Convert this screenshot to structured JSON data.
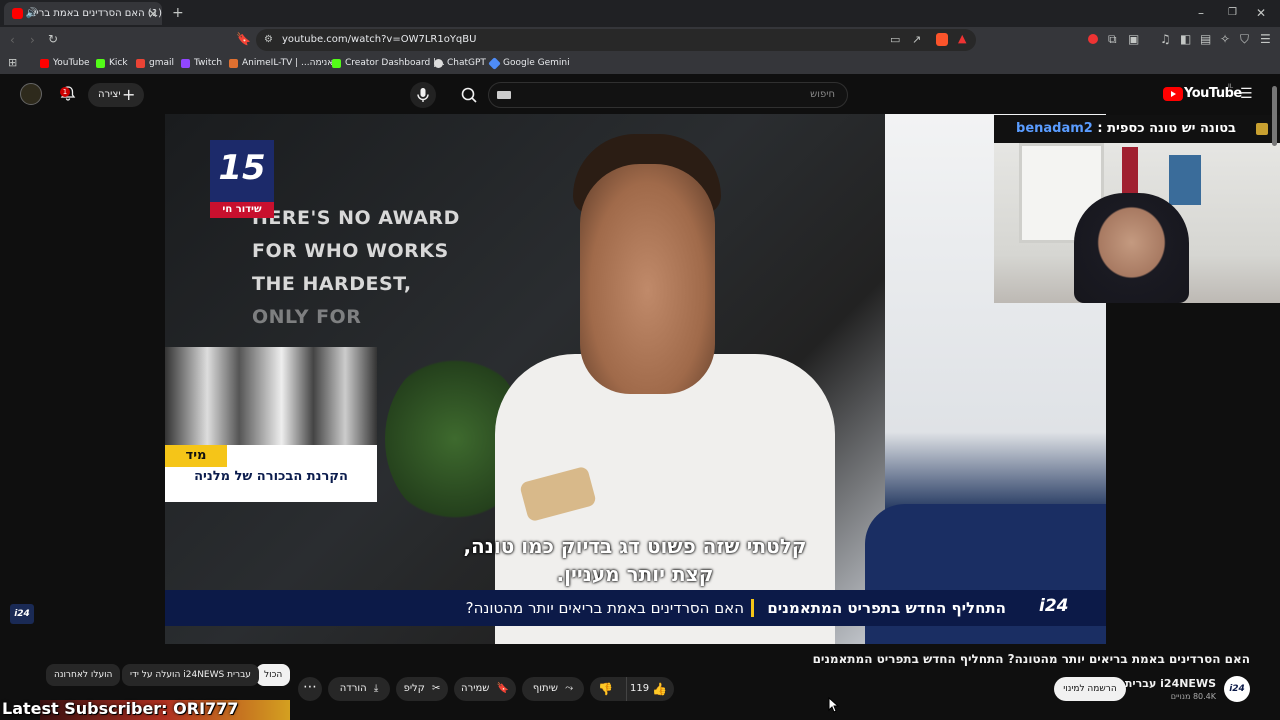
{
  "browser": {
    "tab_title": "(1) האם הסרדינים באמת בריא",
    "url": "youtube.com/watch?v=OW7LR1oYqBU",
    "bookmarks": [
      {
        "label": "YouTube",
        "color": "#ff0000"
      },
      {
        "label": "Kick",
        "color": "#53fc18"
      },
      {
        "label": "gmail",
        "color": "#ea4335"
      },
      {
        "label": "Twitch",
        "color": "#9146ff"
      },
      {
        "label": "AnimeIL-TV | ...אנימה",
        "color": "#e07030"
      },
      {
        "label": "Creator Dashboard |...",
        "color": "#53fc18"
      },
      {
        "label": "ChatGPT",
        "color": "#ffffff"
      },
      {
        "label": "Google Gemini",
        "color": "#4e8cf7"
      }
    ]
  },
  "youtube": {
    "logo_label": "YouTube",
    "logo_sup": "IL",
    "search_placeholder": "חיפוש",
    "create_label": "יצירה",
    "notification_count": "1"
  },
  "video": {
    "channel_badge_number": "15",
    "channel_badge_live": "שידור חי",
    "wall_text_lines": [
      "HERE'S NO AWARD",
      "FOR WHO WORKS",
      "THE HARDEST,",
      "ONLY FOR"
    ],
    "pip_tag": "מיד",
    "pip_text": "הקרנת הבכורה של מלניה",
    "subtitle_line1": "קלטתי שזה פשוט דג בדיוק כמו טונה,",
    "subtitle_line2": "קצת יותר מעניין.",
    "ticker_main": "התחליף החדש בתפריט המתאמנים",
    "ticker_sub": "האם הסרדינים באמת בריאים יותר מהטונה?",
    "ticker_logo": "i24",
    "side_logo": "i24"
  },
  "stream_overlay": {
    "chat_user": "benadam2",
    "chat_message": "בטונה יש טונה כספית",
    "latest_subscriber": "Latest Subscriber: ORI777"
  },
  "below": {
    "title": "האם הסרדינים באמת בריאים יותר מהטונה? התחליף החדש בתפריט המתאמנים",
    "channel_name": "i24NEWS עברית",
    "channel_subs": "80.4K מנויים",
    "channel_avatar": "i24",
    "subscribe_label": "הרשמה למינוי",
    "like_count": "119",
    "share_label": "שיתוף",
    "save_label": "שמירה",
    "clip_label": "קליפ",
    "download_label": "הורדה",
    "chips": [
      "הכול",
      "הועלה על ידי i24NEWS עברית",
      "הועלו לאחרונה"
    ]
  }
}
